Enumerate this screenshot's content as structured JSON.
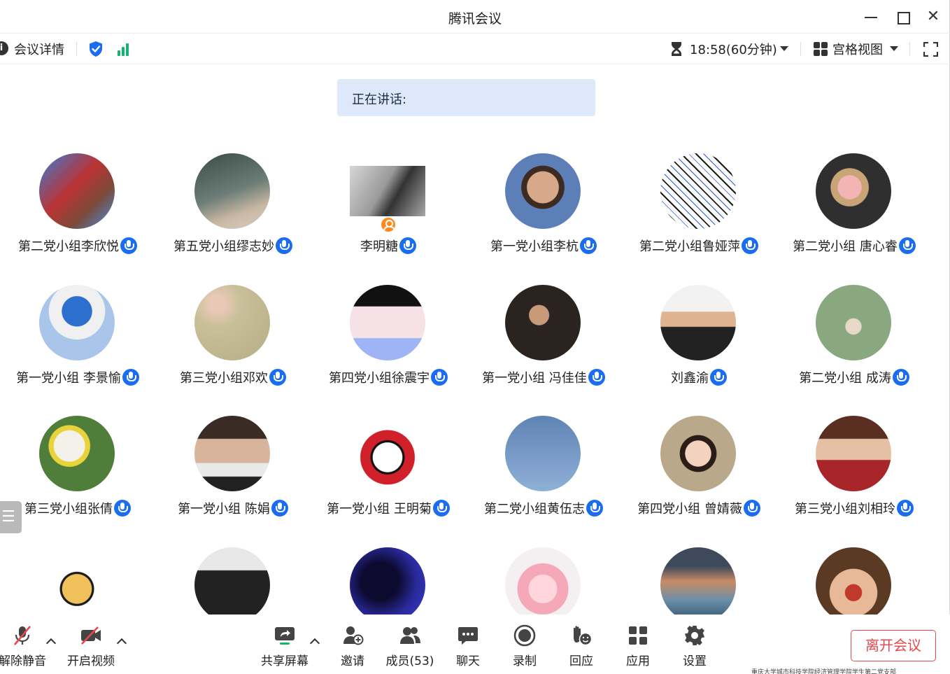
{
  "window": {
    "title": "腾讯会议"
  },
  "infobar": {
    "meeting_details": "会议详情",
    "timer": "18:58(60分钟)",
    "view_mode": "宫格视图"
  },
  "speaking": {
    "label": "正在讲话:"
  },
  "participants": [
    {
      "name": "第二党小组李欣悦",
      "mic": "on"
    },
    {
      "name": "第五党小组缪志妙",
      "mic": "on"
    },
    {
      "name": "李明糖",
      "mic": "on",
      "host": true
    },
    {
      "name": "第一党小组李杭",
      "mic": "on"
    },
    {
      "name": "第二党小组鲁娅萍",
      "mic": "on"
    },
    {
      "name": "第二党小组 唐心睿",
      "mic": "on"
    },
    {
      "name": "第一党小组 李景愉",
      "mic": "on"
    },
    {
      "name": "第三党小组邓欢",
      "mic": "on"
    },
    {
      "name": "第四党小组徐震宇",
      "mic": "on"
    },
    {
      "name": "第一党小组 冯佳佳",
      "mic": "on"
    },
    {
      "name": "刘鑫渝",
      "mic": "on"
    },
    {
      "name": "第二党小组 成涛",
      "mic": "on"
    },
    {
      "name": "第三党小组张倩",
      "mic": "on"
    },
    {
      "name": "第一党小组 陈娟",
      "mic": "on"
    },
    {
      "name": "第一党小组 王明菊",
      "mic": "on"
    },
    {
      "name": "第二党小组黄伍志",
      "mic": "on"
    },
    {
      "name": "第四党小组 曾婧薇",
      "mic": "on"
    },
    {
      "name": "第三党小组刘相玲",
      "mic": "on"
    },
    {
      "name": "",
      "mic": ""
    },
    {
      "name": "",
      "mic": ""
    },
    {
      "name": "",
      "mic": ""
    },
    {
      "name": "",
      "mic": ""
    },
    {
      "name": "",
      "mic": ""
    },
    {
      "name": "",
      "mic": ""
    }
  ],
  "toolbar": {
    "unmute": "解除静音",
    "start_video": "开启视频",
    "share_screen": "共享屏幕",
    "invite": "邀请",
    "members": "成员(53)",
    "chat": "聊天",
    "record": "录制",
    "react": "回应",
    "apps": "应用",
    "settings": "设置",
    "leave": "离开会议"
  },
  "footnote": "重庆大学城市科技学院经济管理学院学生第二党支部",
  "colors": {
    "accent": "#1a6cf0",
    "leave": "#e5484d",
    "banner": "#dde9fb",
    "signal": "#15b371"
  }
}
